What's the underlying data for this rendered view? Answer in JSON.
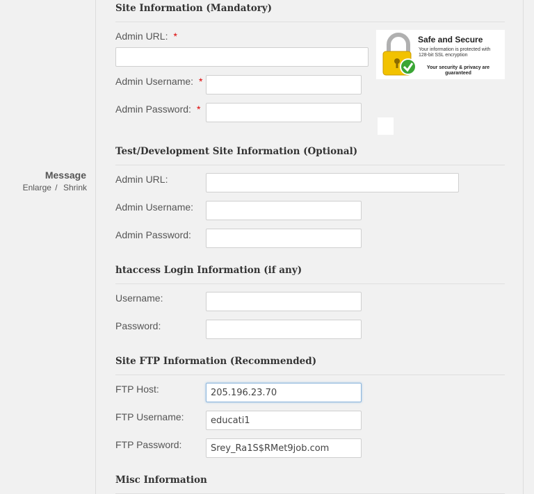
{
  "sidebar": {
    "message_label": "Message",
    "enlarge_label": "Enlarge",
    "separator": "/",
    "shrink_label": "Shrink"
  },
  "site_info": {
    "title": "Site Information (Mandatory)",
    "admin_url_label": "Admin URL:",
    "admin_username_label": "Admin Username:",
    "admin_password_label": "Admin Password:",
    "required_mark": "*",
    "admin_url_value": "",
    "admin_username_value": "",
    "admin_password_value": ""
  },
  "ssl_badge": {
    "title": "Safe and Secure",
    "line1": "Your information is protected with",
    "line2": "128-bit SSL encryption",
    "line3": "Your security & privacy are guaranteed",
    "lock_color": "#f2c200",
    "check_color": "#3aa635"
  },
  "test_site": {
    "title": "Test/Development Site Information (Optional)",
    "admin_url_label": "Admin URL:",
    "admin_username_label": "Admin Username:",
    "admin_password_label": "Admin Password:",
    "admin_url_value": "",
    "admin_username_value": "",
    "admin_password_value": ""
  },
  "htaccess": {
    "title": "htaccess Login Information (if any)",
    "username_label": "Username:",
    "password_label": "Password:",
    "username_value": "",
    "password_value": ""
  },
  "ftp": {
    "title": "Site FTP Information (Recommended)",
    "host_label": "FTP Host:",
    "username_label": "FTP Username:",
    "password_label": "FTP Password:",
    "host_value": "205.196.23.70",
    "username_value": "educati1",
    "password_value": "Srey_Ra1S$RMet9job.com"
  },
  "misc": {
    "title": "Misc Information"
  },
  "colors": {
    "required": "#dd0000",
    "focus_border": "#8eb6dc"
  }
}
